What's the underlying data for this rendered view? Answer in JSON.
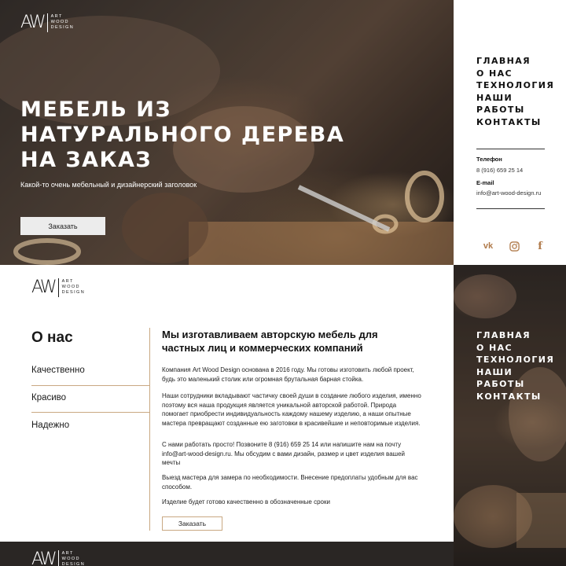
{
  "brand": {
    "mark": "AW",
    "text_lines": [
      "ART",
      "WOOD",
      "DESIGN"
    ]
  },
  "hero": {
    "title_lines": [
      "Мебель из",
      "натурального дерева",
      "на заказ"
    ],
    "subtitle": "Какой-то очень мебельный и дизайнерский заголовок",
    "order_button": "Заказать"
  },
  "nav": {
    "items": [
      "Главная",
      "О нас",
      "Технология",
      "Наши",
      "работы",
      "Контакты"
    ]
  },
  "contacts": {
    "phone_label": "Телефон",
    "phone_value": "8 (916) 659 25 14",
    "email_label": "E-mail",
    "email_value": "info@art-wood-design.ru"
  },
  "socials": [
    {
      "name": "vk-icon",
      "glyph": "vk"
    },
    {
      "name": "instagram-icon",
      "glyph": ""
    },
    {
      "name": "facebook-icon",
      "glyph": "f"
    }
  ],
  "about": {
    "heading": "О нас",
    "features": [
      "Качественно",
      "Красиво",
      "Надежно"
    ],
    "title": "Мы изготавливаем авторскую мебель для частных лиц и коммерческих компаний",
    "paragraphs": [
      "Компания Art Wood Design основана в 2016 году. Мы готовы изготовить любой проект, будь это маленький столик или огромная брутальная барная стойка.",
      "Наши сотрудники вкладывают частичку своей души в создание любого изделия, именно поэтому вся наша продукция является уникальной авторской работой. Природа помогает приобрести индивидуальность каждому нашему изделию, а наши опытные мастера превращают созданные ею заготовки в красивейшие и неповторимые изделия.",
      "С нами работать просто! Позвоните 8 (916) 659 25 14 или напишите нам на почту info@art-wood-design.ru. Мы обсудим с вами дизайн, размер и цвет изделия вашей мечты",
      "Выезд мастера для замера по необходимости. Внесение предоплаты удобным для вас способом.",
      "Изделие будет готово качественно в обозначенные сроки"
    ],
    "order_button": "Заказать"
  },
  "colors": {
    "accent": "#c9a882",
    "social": "#b07a4a",
    "dark": "#2a2624"
  }
}
